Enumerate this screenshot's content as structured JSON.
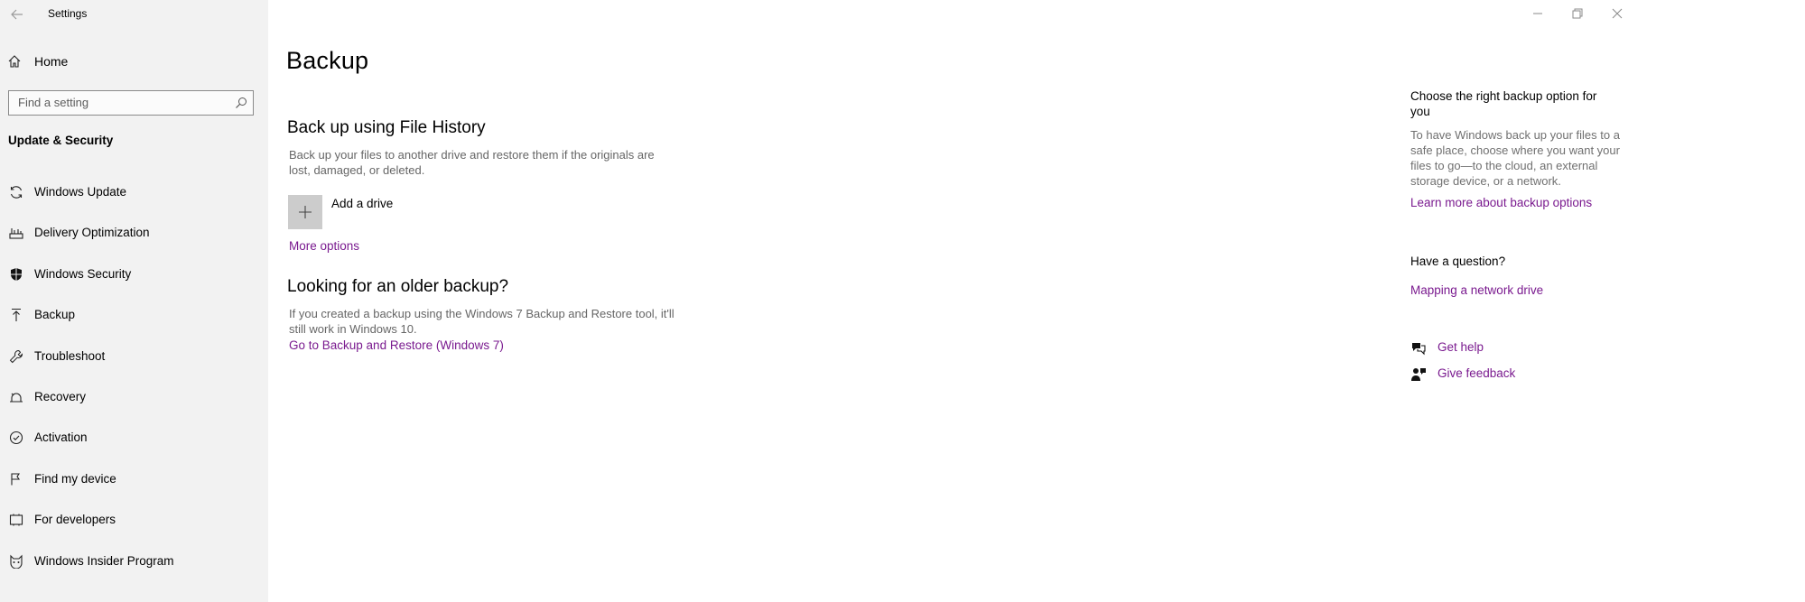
{
  "window": {
    "title": "Settings"
  },
  "sidebar": {
    "home_label": "Home",
    "search_placeholder": "Find a setting",
    "section_title": "Update & Security",
    "items": [
      {
        "label": "Windows Update",
        "icon": "refresh-icon"
      },
      {
        "label": "Delivery Optimization",
        "icon": "delivery-optimization-icon"
      },
      {
        "label": "Windows Security",
        "icon": "shield-icon"
      },
      {
        "label": "Backup",
        "icon": "backup-arrow-icon"
      },
      {
        "label": "Troubleshoot",
        "icon": "wrench-icon"
      },
      {
        "label": "Recovery",
        "icon": "recovery-icon"
      },
      {
        "label": "Activation",
        "icon": "check-circle-icon"
      },
      {
        "label": "Find my device",
        "icon": "find-device-icon"
      },
      {
        "label": "For developers",
        "icon": "developers-icon"
      },
      {
        "label": "Windows Insider Program",
        "icon": "insider-icon"
      }
    ]
  },
  "main": {
    "page_title": "Backup",
    "file_history": {
      "heading": "Back up using File History",
      "description": "Back up your files to another drive and restore them if the originals are lost, damaged, or deleted.",
      "add_drive_label": "Add a drive",
      "more_options_label": "More options"
    },
    "older_backup": {
      "heading": "Looking for an older backup?",
      "description": "If you created a backup using the Windows 7 Backup and Restore tool, it'll still work in Windows 10.",
      "link_label": "Go to Backup and Restore (Windows 7)"
    }
  },
  "right_panel": {
    "choose_title": "Choose the right backup option for you",
    "choose_description": "To have Windows back up your files to a safe place, choose where you want your files to go—to the cloud, an external storage device, or a network.",
    "learn_more_label": "Learn more about backup options",
    "question_title": "Have a question?",
    "mapping_label": "Mapping a network drive",
    "get_help_label": "Get help",
    "feedback_label": "Give feedback"
  },
  "colors": {
    "sidebar_bg": "#f2f2f2",
    "link": "#7a1a8f",
    "secondary_text": "#666666"
  }
}
